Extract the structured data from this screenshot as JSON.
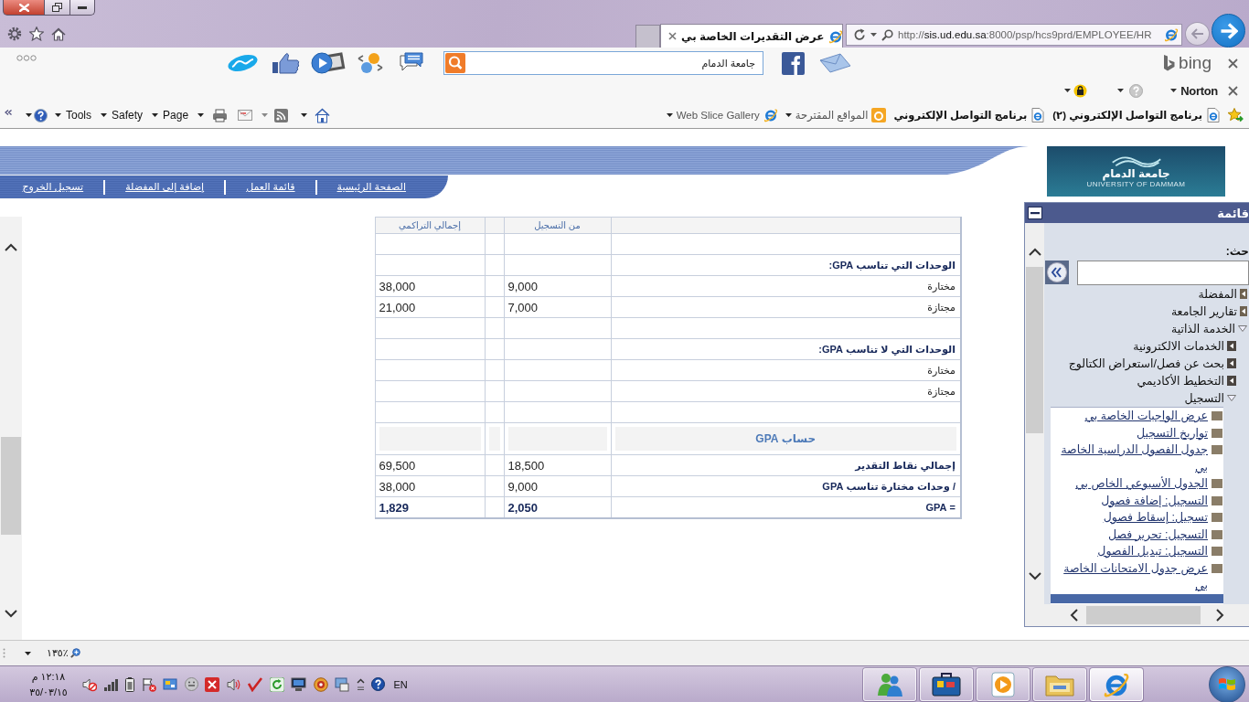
{
  "browser": {
    "tab_title": "عرض التقديرات الخاصة بي",
    "address": "http://**sis.ud.edu.sa**:8000/psp/hcs9prd/EMPLOYEE/HR"
  },
  "toolbar": {
    "search_value": "جامعة الدمام",
    "provider": "bing",
    "security_menu": "Norton"
  },
  "command_bar": {
    "menus": [
      {
        "label": "Page"
      },
      {
        "label": "Safety"
      },
      {
        "label": "Tools"
      }
    ]
  },
  "favorites": [
    {
      "kind": "page",
      "label": "برنامج التواصل الإلكتروني (٢)"
    },
    {
      "kind": "page",
      "label": "برنامج التواصل الإلكتروني"
    },
    {
      "kind": "suggested",
      "label": "المواقع المقترحة"
    },
    {
      "kind": "gallery",
      "label": "Web Slice Gallery"
    }
  ],
  "header": {
    "nav": [
      {
        "label": "الصفحة الرئيسية"
      },
      {
        "label": "قائمة العمل"
      },
      {
        "label": "إضافة إلى المفضلة"
      },
      {
        "label": "تسجيل الخروج"
      }
    ],
    "logo": {
      "title": "جامعة الدمام",
      "subtitle": "UNIVERSITY OF DAMMAM"
    }
  },
  "table": {
    "columns": {
      "term": "من التسجيل",
      "cumulative": "إجمالي التراكمي"
    },
    "rows": [
      {
        "kind": "blank"
      },
      {
        "kind": "section",
        "label": "الوحدات التي تناسب GPA:"
      },
      {
        "kind": "data",
        "label": "مختارة",
        "term": "9,000",
        "cumulative": "38,000"
      },
      {
        "kind": "data",
        "label": "مجتازة",
        "term": "7,000",
        "cumulative": "21,000"
      },
      {
        "kind": "blank"
      },
      {
        "kind": "section",
        "label": "الوحدات التي لا تناسب GPA:"
      },
      {
        "kind": "data",
        "label": "مختارة"
      },
      {
        "kind": "data",
        "label": "مجتازة"
      },
      {
        "kind": "blank"
      },
      {
        "kind": "heading",
        "label": "حساب GPA"
      },
      {
        "kind": "calc",
        "label": "إجمالي نقاط التقدير",
        "term": "18,500",
        "cumulative": "69,500"
      },
      {
        "kind": "calc",
        "label": "/  وحدات مختارة تناسب GPA",
        "term": "9,000",
        "cumulative": "38,000"
      },
      {
        "kind": "result",
        "label": "= GPA",
        "term": "2,050",
        "cumulative": "1,829"
      }
    ]
  },
  "sidebar": {
    "title": "قائمة",
    "search_label": "حث:",
    "tree": [
      {
        "label": "المفضلة",
        "expanded": false
      },
      {
        "label": "تقارير الجامعة",
        "expanded": false
      },
      {
        "label": "الخدمة الذاتية",
        "expanded": true,
        "children": [
          {
            "label": "الخدمات الالكترونية",
            "expanded": false
          },
          {
            "label": "بحث عن فصل/استعراض الكتالوج",
            "expanded": false
          },
          {
            "label": "التخطيط الأكاديمي",
            "expanded": false
          },
          {
            "label": "التسجيل",
            "expanded": true,
            "children": [
              {
                "label": "عرض الواجبات الخاصة بي",
                "selected": false
              },
              {
                "label": "تواريخ التسجيل",
                "selected": false
              },
              {
                "label": "جدول الفصول الدراسية الخاصة بي",
                "selected": false
              },
              {
                "label": "الجدول الأسبوعي الخاص بي",
                "selected": false
              },
              {
                "label": "التسجيل: إضافة فصول",
                "selected": false
              },
              {
                "label": "تسجيل: إسقاط فصول",
                "selected": false
              },
              {
                "label": "التسجيل: تحرير فصل",
                "selected": false
              },
              {
                "label": "التسجيل: تبديل الفصول",
                "selected": false
              },
              {
                "label": "عرض جدول الامتحانات الخاصة بي",
                "selected": false
              },
              {
                "selected": true
              }
            ]
          }
        ]
      }
    ]
  },
  "status_bar": {
    "zoom": "١٣٥٪"
  },
  "taskbar": {
    "time": "١٢:١٨ م",
    "date": "٣٥/٠٣/١٥",
    "language": "EN",
    "apps": [
      {
        "kind": "browser",
        "selected": true
      },
      {
        "kind": "folder",
        "selected": false
      },
      {
        "kind": "media",
        "selected": false
      },
      {
        "kind": "briefcase",
        "selected": false
      },
      {
        "kind": "people",
        "selected": false
      }
    ]
  }
}
